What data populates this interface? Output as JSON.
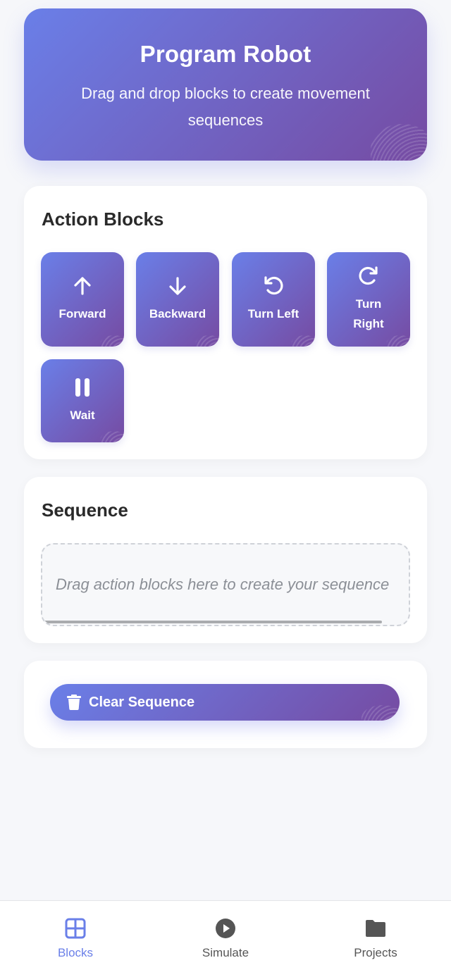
{
  "header": {
    "title": "Program Robot",
    "subtitle": "Drag and drop blocks to create movement sequences"
  },
  "action_blocks": {
    "title": "Action Blocks",
    "items": [
      {
        "label": "Forward",
        "icon": "arrow-up-icon"
      },
      {
        "label": "Backward",
        "icon": "arrow-down-icon"
      },
      {
        "label": "Turn Left",
        "icon": "rotate-left-icon"
      },
      {
        "label": "Turn Right",
        "icon": "rotate-right-icon"
      },
      {
        "label": "Wait",
        "icon": "pause-icon"
      }
    ]
  },
  "sequence": {
    "title": "Sequence",
    "placeholder": "Drag action blocks here to create your sequence"
  },
  "actions": {
    "clear_label": "Clear Sequence",
    "clear_icon": "trash-icon"
  },
  "tabs": [
    {
      "label": "Blocks",
      "icon": "grid-icon",
      "active": true
    },
    {
      "label": "Simulate",
      "icon": "play-circle-icon",
      "active": false
    },
    {
      "label": "Projects",
      "icon": "folder-icon",
      "active": false
    }
  ],
  "colors": {
    "gradient_start": "#6a7fe8",
    "gradient_end": "#764ba2",
    "background": "#f6f7fa",
    "active_tab": "#6a7fe8"
  }
}
